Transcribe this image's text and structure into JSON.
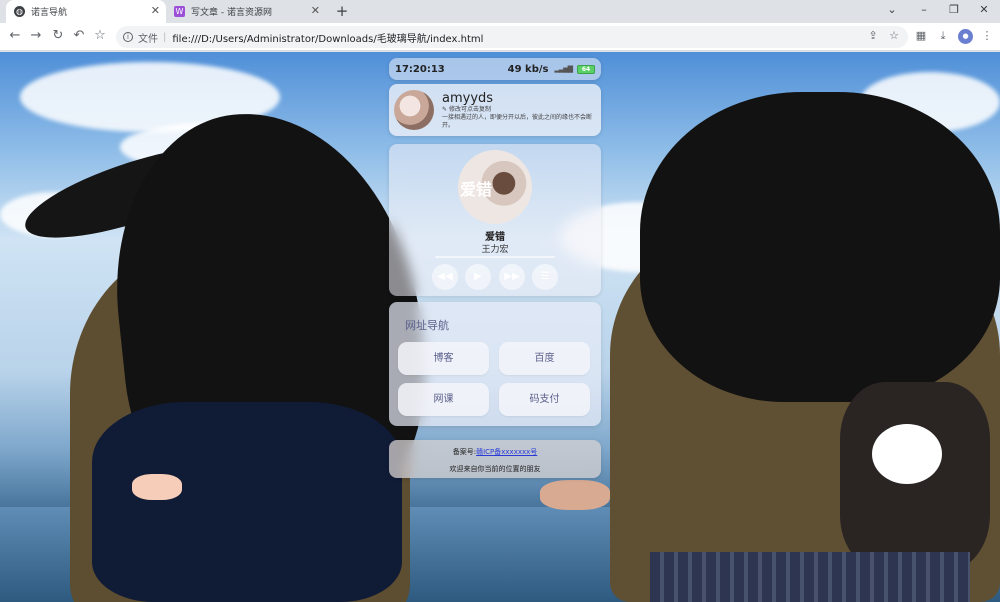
{
  "browser": {
    "tabs": [
      {
        "title": "诺言导航",
        "active": true
      },
      {
        "title": "写文章 - 诺言资源网",
        "active": false
      }
    ],
    "address": {
      "scheme_label": "文件",
      "url": "file:///D:/Users/Administrator/Downloads/毛玻璃导航/index.html"
    }
  },
  "status_bar": {
    "time": "17:20:13",
    "speed": "49 kb/s",
    "battery": "64"
  },
  "profile": {
    "name": "amyyds",
    "edit_hint": "修改可点击复制",
    "motto": "一接相遇过的人，即便分开以后，彼此之间的缘也不会断开。"
  },
  "music": {
    "cover_text": "爱错",
    "title": "爱错",
    "artist": "王力宏",
    "progress": 0.0
  },
  "site_nav": {
    "title": "网址导航",
    "links": [
      "博客",
      "百度",
      "网课",
      "码支付"
    ]
  },
  "footer": {
    "icp_label": "备案号:",
    "icp_number": "赣ICP备xxxxxxx号",
    "welcome": "欢迎来自你当前的位置的朋友"
  },
  "colors": {
    "accent": "#5a5f8a",
    "link": "#2a3bd6",
    "battery": "#5bd067"
  }
}
